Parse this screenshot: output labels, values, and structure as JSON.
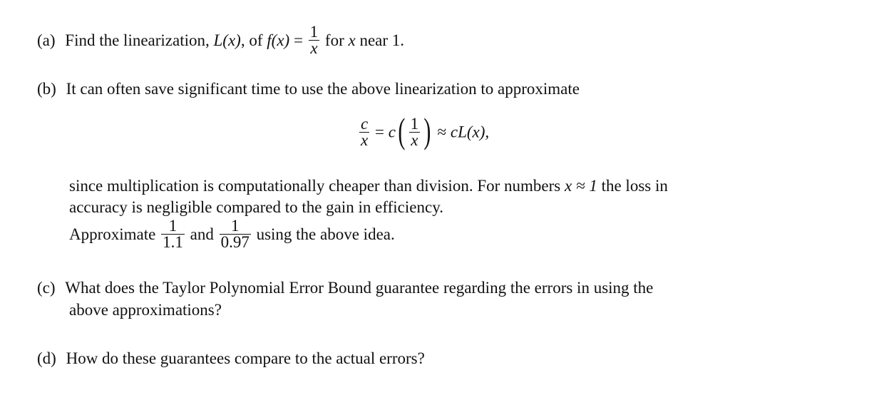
{
  "parts": {
    "a": {
      "label": "(a)",
      "text_before": "Find the linearization, ",
      "Lx": "L(x)",
      "text_mid": ", of ",
      "fx": "f(x)",
      "equals": " = ",
      "frac_num": "1",
      "frac_den": "x",
      "text_after_1": " for ",
      "var_x": "x",
      "text_after_2": " near 1."
    },
    "b": {
      "label": "(b)",
      "intro": "It can often save significant time to use the above linearization to approximate",
      "display": {
        "lhs_num": "c",
        "lhs_den": "x",
        "eq": " = ",
        "c": "c",
        "inner_num": "1",
        "inner_den": "x",
        "approx": " ≈ ",
        "rhs": "cL(x),"
      },
      "line1_before": "since multiplication is computationally cheaper than division. For numbers ",
      "line1_math": "x ≈ 1",
      "line1_after": " the loss in",
      "line2": "accuracy is negligible compared to the gain in efficiency.",
      "approx_prefix": "Approximate ",
      "frac1_num": "1",
      "frac1_den": "1.1",
      "and": " and ",
      "frac2_num": "1",
      "frac2_den": "0.97",
      "approx_suffix": " using the above idea."
    },
    "c": {
      "label": "(c)",
      "line1": "What does the Taylor Polynomial Error Bound guarantee regarding the errors in using the",
      "line2": "above approximations?"
    },
    "d": {
      "label": "(d)",
      "text": "How do these guarantees compare to the actual errors?"
    }
  }
}
